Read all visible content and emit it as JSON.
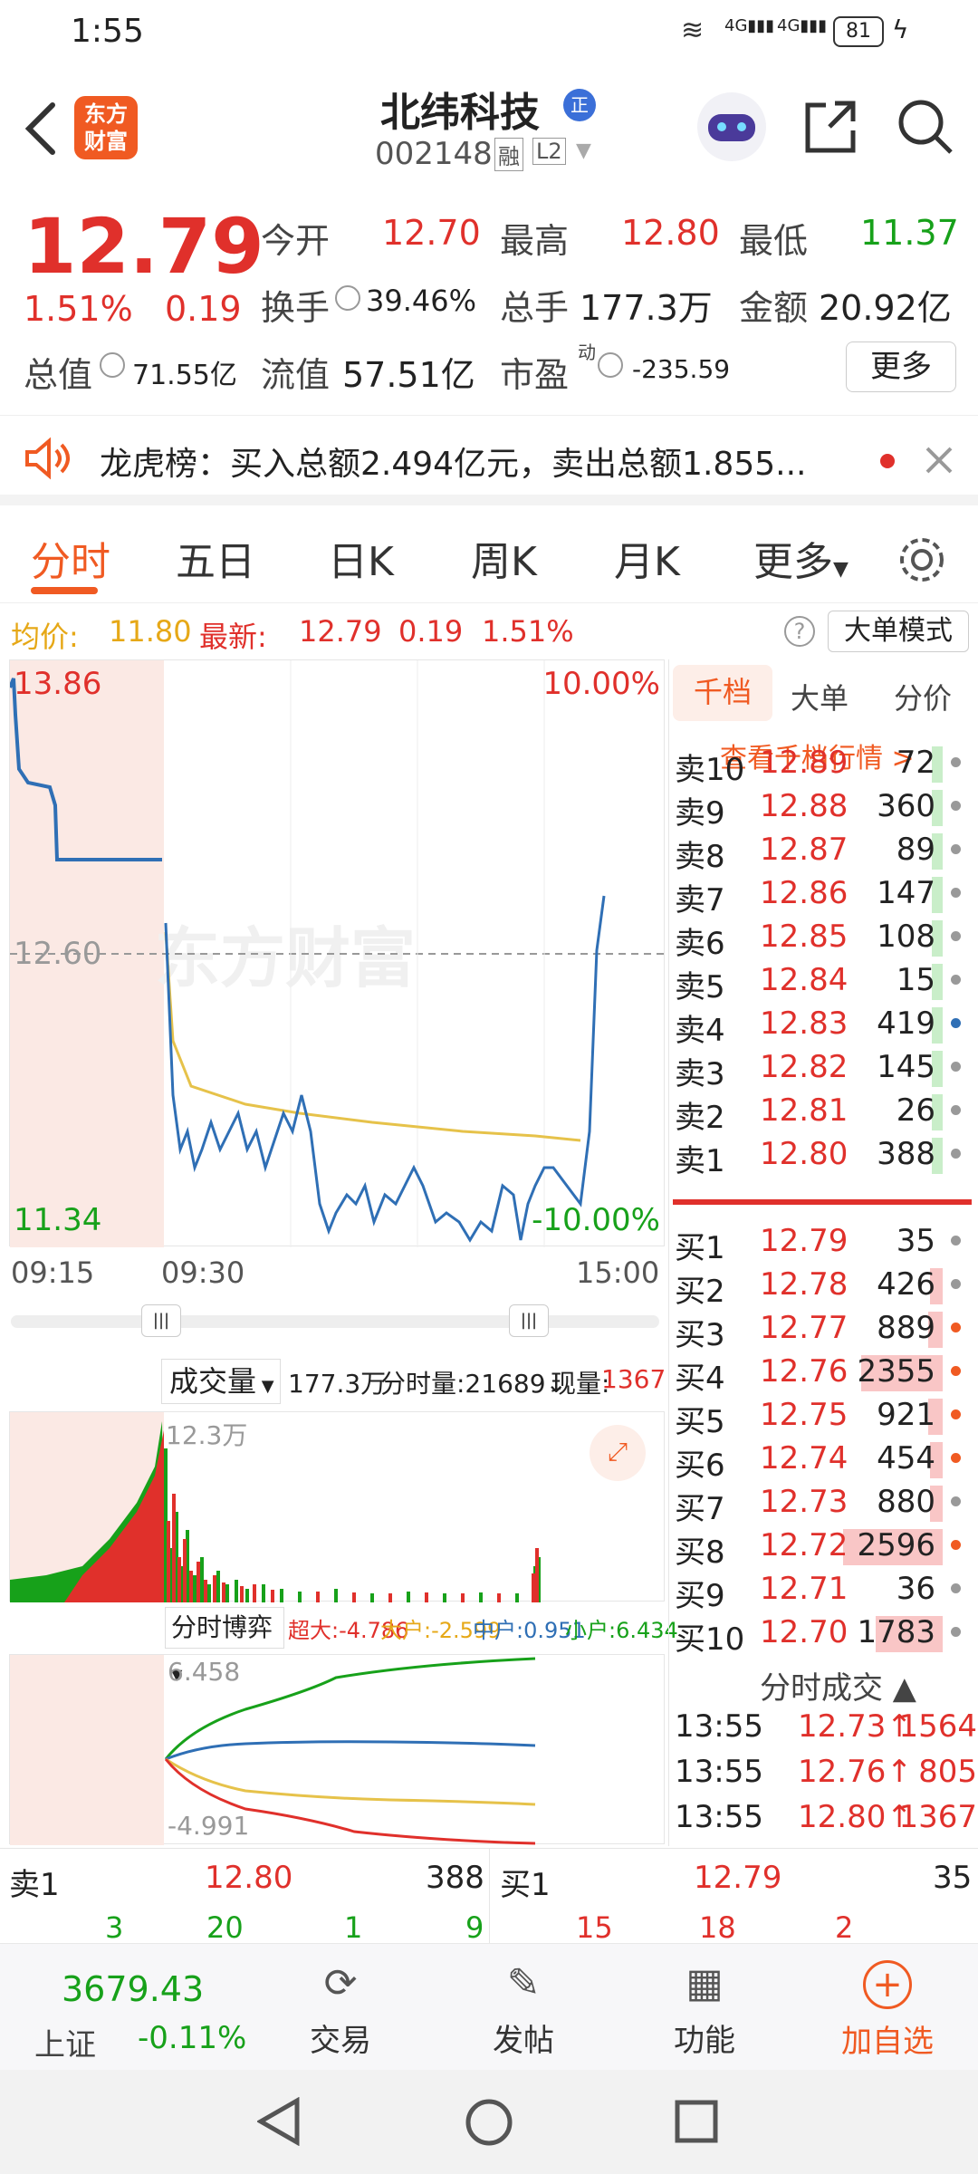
{
  "status": {
    "time": "1:55",
    "signal_left": "4G",
    "signal_right": "4G",
    "battery": "81"
  },
  "header": {
    "logo_line1": "东方",
    "logo_line2": "财富",
    "name": "北纬科技",
    "name_badge": "正",
    "code": "002148",
    "tag_rong": "融",
    "tag_l2": "L2"
  },
  "quote": {
    "price": "12.79",
    "pct": "1.51%",
    "chg": "0.19",
    "open_label": "今开",
    "open": "12.70",
    "high_label": "最高",
    "high": "12.80",
    "low_label": "最低",
    "low": "11.37",
    "turnover_label": "换手",
    "turnover": "39.46%",
    "vol_label": "总手",
    "vol": "177.3万",
    "amt_label": "金额",
    "amt": "20.92亿",
    "mcap_label": "总值",
    "mcap": "71.55亿",
    "float_label": "流值",
    "float": "57.51亿",
    "pe_label": "市盈",
    "pe_sup": "动",
    "pe": "-235.59",
    "more": "更多"
  },
  "notice": {
    "text": "龙虎榜：买入总额2.494亿元，卖出总额1.855..."
  },
  "tabs": [
    "分时",
    "五日",
    "日K",
    "周K",
    "月K",
    "更多"
  ],
  "avg": {
    "avg_label": "均价:",
    "avg": "11.80",
    "latest_label": "最新:",
    "latest": "12.79",
    "chg": "0.19",
    "pct": "1.51%",
    "mode": "大单模式"
  },
  "chart": {
    "y_top": "13.86",
    "y_mid": "12.60",
    "y_bot": "11.34",
    "pct_top": "10.00%",
    "pct_bot": "-10.00%",
    "t_start": "09:15",
    "t_mid": "09:30",
    "t_end": "15:00",
    "watermark": "东方财富"
  },
  "volume": {
    "selector": "成交量",
    "total": "177.3万",
    "fenshi": "分时量:21689↓",
    "xian_label": "现量:",
    "xian": "1367",
    "max": "12.3万"
  },
  "game": {
    "selector": "分时博弈",
    "chaoda": "超大:-4.786",
    "dahu": "大户:-2.599",
    "zhonghu": "中户:0.951",
    "xiaohu": "小户:6.434",
    "top": "6.458",
    "bot": "-4.991"
  },
  "chart_data": {
    "type": "line",
    "title": "",
    "x_ticks": [
      "09:15",
      "09:30",
      "15:00"
    ],
    "y_range": [
      11.34,
      13.86
    ],
    "ref_price": 12.6,
    "series": [
      {
        "name": "",
        "values": [
          13.86,
          13.7,
          13.5,
          13.45,
          13.4,
          13.2,
          13.2,
          13.2,
          13.2,
          13.2
        ]
      }
    ]
  },
  "orderbook": {
    "tabs": [
      "千档",
      "大单",
      "分价"
    ],
    "link": "查看千档行情 >",
    "sell": [
      {
        "l": "卖10",
        "p": "12.89",
        "v": "72"
      },
      {
        "l": "卖9",
        "p": "12.88",
        "v": "360"
      },
      {
        "l": "卖8",
        "p": "12.87",
        "v": "89"
      },
      {
        "l": "卖7",
        "p": "12.86",
        "v": "147"
      },
      {
        "l": "卖6",
        "p": "12.85",
        "v": "108"
      },
      {
        "l": "卖5",
        "p": "12.84",
        "v": "15"
      },
      {
        "l": "卖4",
        "p": "12.83",
        "v": "419"
      },
      {
        "l": "卖3",
        "p": "12.82",
        "v": "145"
      },
      {
        "l": "卖2",
        "p": "12.81",
        "v": "26"
      },
      {
        "l": "卖1",
        "p": "12.80",
        "v": "388"
      }
    ],
    "buy": [
      {
        "l": "买1",
        "p": "12.79",
        "v": "35"
      },
      {
        "l": "买2",
        "p": "12.78",
        "v": "426"
      },
      {
        "l": "买3",
        "p": "12.77",
        "v": "889"
      },
      {
        "l": "买4",
        "p": "12.76",
        "v": "2355"
      },
      {
        "l": "买5",
        "p": "12.75",
        "v": "921"
      },
      {
        "l": "买6",
        "p": "12.74",
        "v": "454"
      },
      {
        "l": "买7",
        "p": "12.73",
        "v": "880"
      },
      {
        "l": "买8",
        "p": "12.72",
        "v": "2596"
      },
      {
        "l": "买9",
        "p": "12.71",
        "v": "36"
      },
      {
        "l": "买10",
        "p": "12.70",
        "v": "1783"
      }
    ],
    "ticks_title": "分时成交",
    "ticks": [
      {
        "t": "13:55",
        "p": "12.73",
        "a": "↑",
        "v": "1564"
      },
      {
        "t": "13:55",
        "p": "12.76",
        "a": "↑",
        "v": "805"
      },
      {
        "t": "13:55",
        "p": "12.80",
        "a": "↑",
        "v": "1367"
      }
    ]
  },
  "bidask": {
    "sell_label": "卖1",
    "sell_price": "12.80",
    "sell_vol": "388",
    "buy_label": "买1",
    "buy_price": "12.79",
    "buy_vol": "35",
    "row": [
      "3",
      "20",
      "1",
      "9",
      "15",
      "18",
      "2"
    ]
  },
  "bottom": {
    "index": "3679.43",
    "index_name": "上证",
    "index_chg": "-0.11%",
    "trade": "交易",
    "post": "发帖",
    "func": "功能",
    "add": "加自选"
  }
}
